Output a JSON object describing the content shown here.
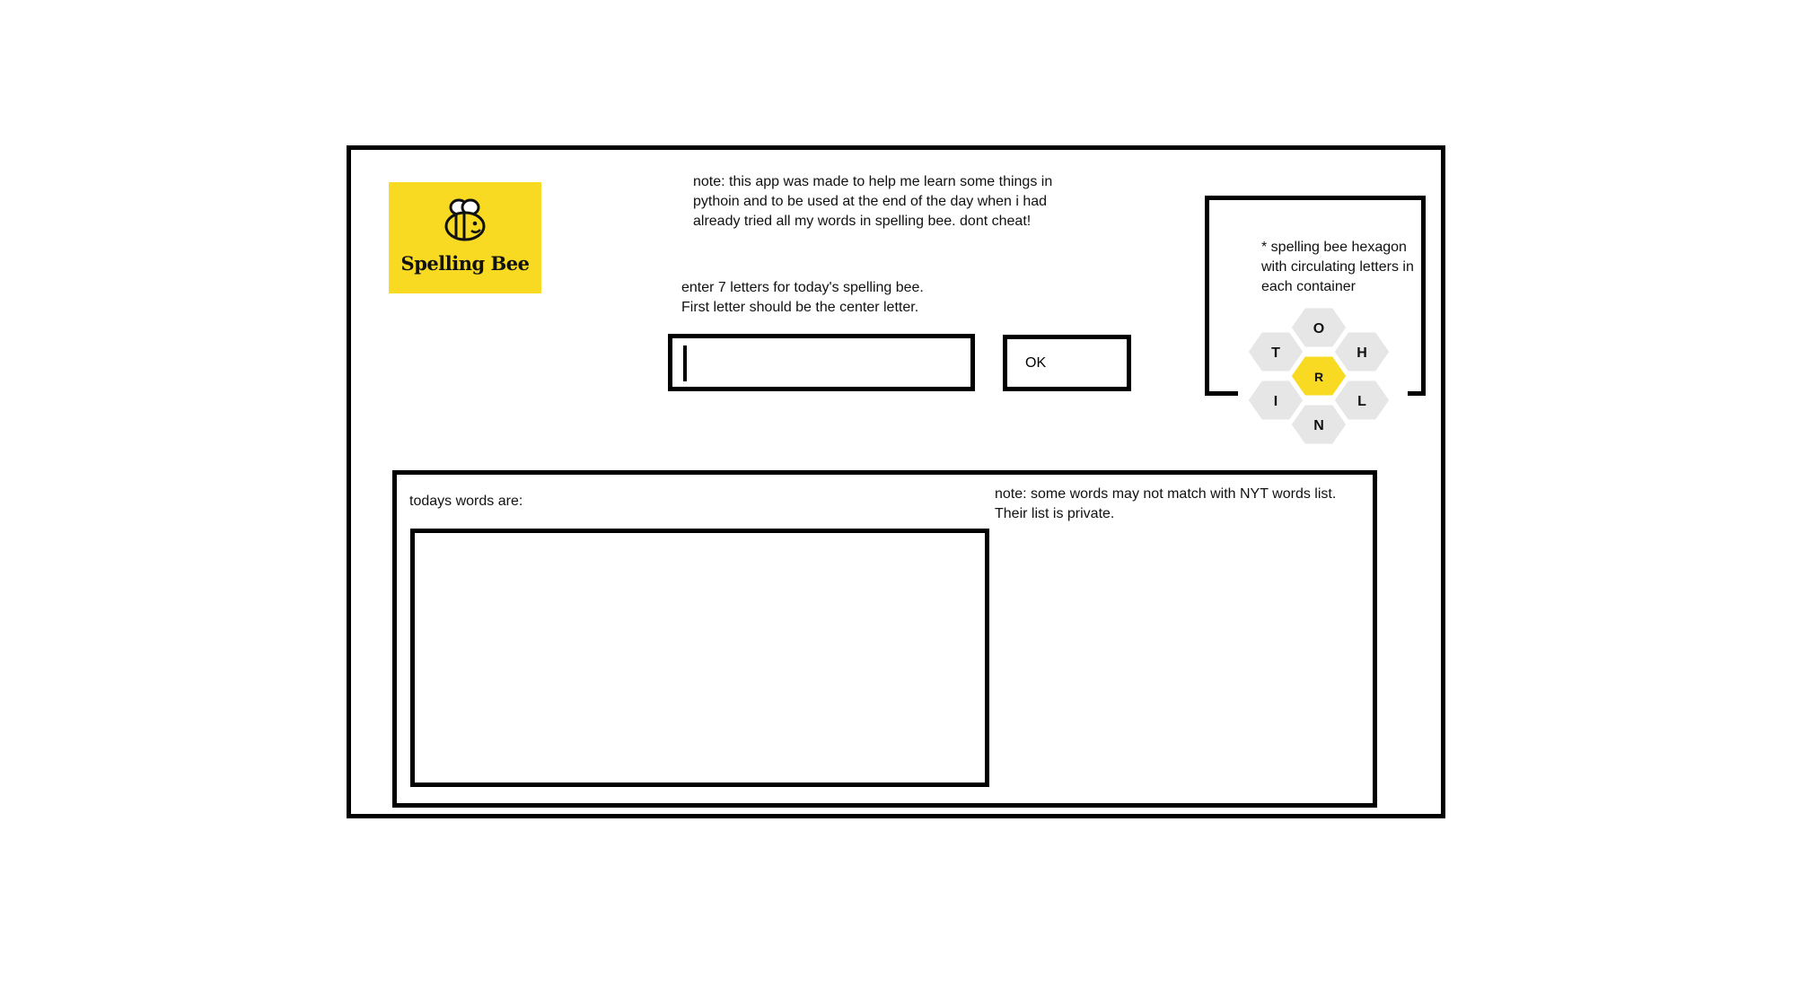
{
  "logo": {
    "text": "Spelling Bee",
    "icon": "bee-icon",
    "background": "#f7da21"
  },
  "note_top": {
    "text": "note: this app was made to help me learn some things in\npythoin and to be used at the end of the day when i had\nalready tried all my words in spelling bee. dont cheat!"
  },
  "instructions": {
    "text": "enter 7 letters for today's spelling bee.\nFirst letter should be the center letter."
  },
  "letters_input": {
    "value": "",
    "placeholder": ""
  },
  "ok_button": {
    "label": "OK"
  },
  "hexagon_panel": {
    "note_lines": [
      "* spelling bee hexagon",
      "with circulating letters in",
      "each container"
    ],
    "center_letter": "R",
    "outer_letters": {
      "top": "O",
      "upper_left": "T",
      "upper_right": "H",
      "lower_left": "I",
      "lower_right": "L",
      "bottom": "N"
    },
    "center_color": "#f7da21",
    "outer_color": "#e6e6e6"
  },
  "results": {
    "label": "todays words are:",
    "words": [],
    "note": "note: some words may not match with NYT words list.\nTheir list is private."
  }
}
